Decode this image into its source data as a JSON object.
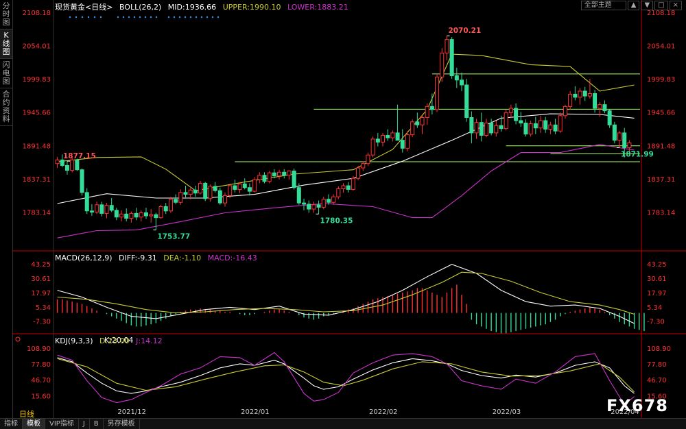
{
  "sidebar": {
    "tabs": [
      "分时图",
      "K线图",
      "闪电图",
      "合约资料"
    ],
    "active": 1
  },
  "header": {
    "instrument": "现货黄金<日线>",
    "boll": "BOLL(26,2)",
    "mid": "MID:1936.66",
    "upper": "UPPER:1990.10",
    "lower": "LOWER:1883.21",
    "theme_button": "全部主题"
  },
  "macd_header": {
    "name": "MACD(26,12,9)",
    "diff": "DIFF:-9.31",
    "dea": "DEA:-1.10",
    "macd": "MACD:-16.43"
  },
  "kdj_header": {
    "name": "KDJ(9,3,3)",
    "k": "K:20.04",
    "d": "D:23.00",
    "j": "J:14.12"
  },
  "period_label": "日线",
  "bottom_tabs": [
    "指标",
    "模板",
    "VIP指标",
    "J",
    "B",
    "另存模板"
  ],
  "watermark": "FX678",
  "colors": {
    "up": "#ff3333",
    "down": "#33dd99",
    "mid": "#ffffff",
    "upper": "#cccc33",
    "lower": "#cc33cc",
    "levels": "#aaff66",
    "bg": "#000000"
  },
  "chart_data": {
    "type": "candlestick",
    "main_axis": {
      "ticks": [
        "2108.18",
        "2054.01",
        "1999.83",
        "1945.66",
        "1891.48",
        "1837.31",
        "1783.14"
      ],
      "ylim": [
        1729,
        2108.18
      ]
    },
    "x_labels": [
      "2021/12",
      "2022/01",
      "2022/02",
      "2022/03",
      "2022/04"
    ],
    "annotations": [
      {
        "label": "1877.15",
        "index": 2,
        "type": "high"
      },
      {
        "label": "1753.77",
        "index": 20,
        "type": "low"
      },
      {
        "label": "1780.35",
        "index": 53,
        "type": "low"
      },
      {
        "label": "2070.21",
        "index": 79,
        "type": "high"
      },
      {
        "label": "1871.99",
        "index": 114,
        "type": "low"
      }
    ],
    "horizontal_levels": [
      2008,
      1950.5,
      1865,
      1878,
      1891
    ],
    "ohlc": [
      [
        1862,
        1873,
        1855,
        1868
      ],
      [
        1868,
        1877,
        1856,
        1859
      ],
      [
        1859,
        1866,
        1844,
        1851
      ],
      [
        1851,
        1872,
        1848,
        1868
      ],
      [
        1868,
        1870,
        1850,
        1852
      ],
      [
        1852,
        1854,
        1810,
        1815
      ],
      [
        1815,
        1822,
        1780,
        1785
      ],
      [
        1785,
        1796,
        1777,
        1783
      ],
      [
        1783,
        1800,
        1780,
        1795
      ],
      [
        1795,
        1800,
        1776,
        1781
      ],
      [
        1781,
        1798,
        1773,
        1794
      ],
      [
        1794,
        1806,
        1783,
        1786
      ],
      [
        1786,
        1790,
        1770,
        1775
      ],
      [
        1775,
        1786,
        1768,
        1780
      ],
      [
        1780,
        1789,
        1768,
        1773
      ],
      [
        1773,
        1784,
        1766,
        1781
      ],
      [
        1781,
        1790,
        1770,
        1775
      ],
      [
        1775,
        1786,
        1768,
        1782
      ],
      [
        1782,
        1790,
        1772,
        1777
      ],
      [
        1777,
        1788,
        1766,
        1779
      ],
      [
        1779,
        1782,
        1754,
        1774
      ],
      [
        1774,
        1795,
        1772,
        1792
      ],
      [
        1792,
        1798,
        1780,
        1785
      ],
      [
        1785,
        1808,
        1782,
        1804
      ],
      [
        1804,
        1812,
        1796,
        1799
      ],
      [
        1799,
        1820,
        1795,
        1815
      ],
      [
        1815,
        1826,
        1807,
        1812
      ],
      [
        1812,
        1822,
        1804,
        1819
      ],
      [
        1819,
        1826,
        1808,
        1814
      ],
      [
        1814,
        1834,
        1812,
        1830
      ],
      [
        1830,
        1832,
        1801,
        1805
      ],
      [
        1805,
        1828,
        1800,
        1825
      ],
      [
        1825,
        1832,
        1815,
        1818
      ],
      [
        1818,
        1823,
        1795,
        1798
      ],
      [
        1798,
        1815,
        1792,
        1810
      ],
      [
        1810,
        1829,
        1806,
        1826
      ],
      [
        1826,
        1836,
        1815,
        1820
      ],
      [
        1820,
        1832,
        1814,
        1829
      ],
      [
        1829,
        1838,
        1820,
        1823
      ],
      [
        1823,
        1830,
        1810,
        1817
      ],
      [
        1817,
        1840,
        1815,
        1836
      ],
      [
        1836,
        1848,
        1830,
        1843
      ],
      [
        1843,
        1848,
        1830,
        1833
      ],
      [
        1833,
        1850,
        1830,
        1847
      ],
      [
        1847,
        1853,
        1838,
        1842
      ],
      [
        1842,
        1852,
        1836,
        1848
      ],
      [
        1848,
        1853,
        1838,
        1843
      ],
      [
        1843,
        1851,
        1836,
        1850
      ],
      [
        1850,
        1854,
        1820,
        1823
      ],
      [
        1823,
        1830,
        1795,
        1798
      ],
      [
        1798,
        1805,
        1786,
        1796
      ],
      [
        1796,
        1802,
        1782,
        1788
      ],
      [
        1788,
        1800,
        1782,
        1795
      ],
      [
        1795,
        1802,
        1780,
        1791
      ],
      [
        1791,
        1808,
        1788,
        1804
      ],
      [
        1804,
        1812,
        1795,
        1799
      ],
      [
        1799,
        1812,
        1795,
        1808
      ],
      [
        1808,
        1825,
        1804,
        1821
      ],
      [
        1821,
        1830,
        1815,
        1826
      ],
      [
        1826,
        1832,
        1815,
        1820
      ],
      [
        1820,
        1842,
        1818,
        1838
      ],
      [
        1838,
        1858,
        1835,
        1855
      ],
      [
        1855,
        1866,
        1850,
        1862
      ],
      [
        1862,
        1880,
        1858,
        1876
      ],
      [
        1876,
        1906,
        1872,
        1902
      ],
      [
        1902,
        1912,
        1890,
        1897
      ],
      [
        1897,
        1912,
        1890,
        1908
      ],
      [
        1908,
        1918,
        1899,
        1904
      ],
      [
        1904,
        1916,
        1898,
        1912
      ],
      [
        1912,
        1958,
        1900,
        1900
      ],
      [
        1900,
        1918,
        1880,
        1887
      ],
      [
        1887,
        1915,
        1882,
        1909
      ],
      [
        1909,
        1934,
        1905,
        1930
      ],
      [
        1930,
        1945,
        1920,
        1925
      ],
      [
        1925,
        1940,
        1910,
        1937
      ],
      [
        1937,
        1960,
        1925,
        1955
      ],
      [
        1955,
        1976,
        1942,
        1950
      ],
      [
        1950,
        2008,
        1946,
        2003
      ],
      [
        2003,
        2050,
        1995,
        2042
      ],
      [
        2042,
        2070,
        2030,
        2064
      ],
      [
        2064,
        2068,
        2000,
        2005
      ],
      [
        2005,
        2018,
        1985,
        1998
      ],
      [
        1998,
        2010,
        1980,
        1990
      ],
      [
        1990,
        2000,
        1930,
        1937
      ],
      [
        1937,
        1947,
        1895,
        1912
      ],
      [
        1912,
        1935,
        1902,
        1929
      ],
      [
        1929,
        1945,
        1898,
        1908
      ],
      [
        1908,
        1935,
        1905,
        1928
      ],
      [
        1928,
        1935,
        1908,
        1912
      ],
      [
        1912,
        1932,
        1906,
        1924
      ],
      [
        1924,
        1940,
        1914,
        1919
      ],
      [
        1919,
        1950,
        1916,
        1945
      ],
      [
        1945,
        1958,
        1936,
        1952
      ],
      [
        1952,
        1960,
        1926,
        1932
      ],
      [
        1932,
        1946,
        1922,
        1928
      ],
      [
        1928,
        1934,
        1906,
        1910
      ],
      [
        1910,
        1932,
        1906,
        1927
      ],
      [
        1927,
        1938,
        1910,
        1920
      ],
      [
        1920,
        1940,
        1912,
        1932
      ],
      [
        1932,
        1938,
        1912,
        1918
      ],
      [
        1918,
        1930,
        1910,
        1925
      ],
      [
        1925,
        1935,
        1910,
        1915
      ],
      [
        1915,
        1945,
        1912,
        1940
      ],
      [
        1940,
        1958,
        1935,
        1955
      ],
      [
        1955,
        1980,
        1950,
        1975
      ],
      [
        1975,
        1988,
        1965,
        1970
      ],
      [
        1970,
        1985,
        1958,
        1980
      ],
      [
        1980,
        1987,
        1964,
        1972
      ],
      [
        1972,
        2000,
        1968,
        1976
      ],
      [
        1976,
        1982,
        1945,
        1952
      ],
      [
        1952,
        1962,
        1938,
        1958
      ],
      [
        1958,
        1965,
        1944,
        1948
      ],
      [
        1948,
        1950,
        1920,
        1925
      ],
      [
        1925,
        1930,
        1895,
        1900
      ],
      [
        1900,
        1915,
        1888,
        1912
      ],
      [
        1912,
        1920,
        1872,
        1888
      ],
      [
        1888,
        1900,
        1880,
        1896
      ]
    ],
    "boll_mid": [
      [
        0,
        1797
      ],
      [
        10,
        1813
      ],
      [
        20,
        1806
      ],
      [
        30,
        1806
      ],
      [
        40,
        1812
      ],
      [
        50,
        1827
      ],
      [
        60,
        1838
      ],
      [
        70,
        1866
      ],
      [
        80,
        1900
      ],
      [
        90,
        1936
      ],
      [
        100,
        1943
      ],
      [
        110,
        1942
      ],
      [
        117,
        1936
      ]
    ],
    "boll_upper": [
      [
        0,
        1865
      ],
      [
        8,
        1872
      ],
      [
        17,
        1873
      ],
      [
        22,
        1853
      ],
      [
        28,
        1818
      ],
      [
        38,
        1832
      ],
      [
        48,
        1845
      ],
      [
        60,
        1852
      ],
      [
        68,
        1885
      ],
      [
        75,
        1950
      ],
      [
        80,
        2040
      ],
      [
        86,
        2038
      ],
      [
        96,
        2023
      ],
      [
        104,
        2020
      ],
      [
        110,
        1980
      ],
      [
        117,
        1990
      ]
    ],
    "boll_lower": [
      [
        0,
        1741
      ],
      [
        8,
        1753
      ],
      [
        16,
        1754
      ],
      [
        24,
        1766
      ],
      [
        34,
        1782
      ],
      [
        44,
        1790
      ],
      [
        54,
        1797
      ],
      [
        64,
        1792
      ],
      [
        72,
        1774
      ],
      [
        76,
        1774
      ],
      [
        82,
        1810
      ],
      [
        88,
        1850
      ],
      [
        94,
        1880
      ],
      [
        102,
        1880
      ],
      [
        110,
        1893
      ],
      [
        117,
        1884
      ]
    ],
    "macd_axis": {
      "ticks": [
        "43.25",
        "30.61",
        "17.97",
        "5.34",
        "-7.30"
      ],
      "ylim": [
        -19,
        44
      ]
    },
    "diff": [
      [
        0,
        20
      ],
      [
        5,
        14
      ],
      [
        10,
        5
      ],
      [
        15,
        -3
      ],
      [
        20,
        -5
      ],
      [
        25,
        -1
      ],
      [
        30,
        3
      ],
      [
        35,
        5
      ],
      [
        40,
        3
      ],
      [
        45,
        6
      ],
      [
        50,
        -1
      ],
      [
        55,
        -2
      ],
      [
        60,
        3
      ],
      [
        65,
        10
      ],
      [
        70,
        20
      ],
      [
        75,
        32
      ],
      [
        80,
        43
      ],
      [
        85,
        35
      ],
      [
        90,
        20
      ],
      [
        95,
        10
      ],
      [
        100,
        6
      ],
      [
        105,
        7
      ],
      [
        110,
        4
      ],
      [
        114,
        -3
      ],
      [
        117,
        -9.3
      ]
    ],
    "dea": [
      [
        0,
        14
      ],
      [
        6,
        12
      ],
      [
        12,
        8
      ],
      [
        18,
        3
      ],
      [
        24,
        0
      ],
      [
        30,
        1
      ],
      [
        36,
        3
      ],
      [
        42,
        4
      ],
      [
        48,
        3
      ],
      [
        54,
        1
      ],
      [
        60,
        2
      ],
      [
        66,
        7
      ],
      [
        72,
        16
      ],
      [
        78,
        27
      ],
      [
        82,
        36
      ],
      [
        86,
        35
      ],
      [
        92,
        28
      ],
      [
        98,
        18
      ],
      [
        104,
        10
      ],
      [
        110,
        7
      ],
      [
        114,
        3
      ],
      [
        117,
        -1.1
      ]
    ],
    "macd_hist": [
      12,
      12,
      11,
      10,
      9,
      8,
      6,
      4,
      2,
      0,
      -1,
      -3,
      -5,
      -7,
      -9,
      -11,
      -12,
      -12,
      -11,
      -10,
      -9,
      -7,
      -5,
      -3,
      -1,
      1,
      2,
      3,
      3,
      4,
      3,
      3,
      2,
      2,
      1,
      1,
      0,
      -1,
      -2,
      -2,
      -1,
      0,
      1,
      2,
      3,
      3,
      2,
      1,
      0,
      -2,
      -4,
      -5,
      -6,
      -5,
      -3,
      -2,
      -1,
      0,
      2,
      3,
      4,
      6,
      8,
      10,
      12,
      13,
      14,
      15,
      16,
      17,
      18,
      19,
      20,
      22,
      22,
      20,
      18,
      16,
      14,
      18,
      22,
      25,
      16,
      8,
      -6,
      -10,
      -12,
      -14,
      -16,
      -17,
      -18,
      -18,
      -17,
      -16,
      -15,
      -14,
      -13,
      -12,
      -11,
      -10,
      -8,
      -6,
      -3,
      -1,
      1,
      2,
      3,
      4,
      5,
      4,
      3,
      1,
      -2,
      -5,
      -8,
      -10,
      -12,
      -14,
      -15,
      -16
    ],
    "kdj_axis": {
      "ticks": [
        "108.90",
        "77.80",
        "46.70",
        "15.60"
      ],
      "ylim": [
        -4,
        110
      ]
    },
    "k": [
      [
        0,
        90
      ],
      [
        3,
        82
      ],
      [
        6,
        60
      ],
      [
        9,
        40
      ],
      [
        12,
        25
      ],
      [
        15,
        20
      ],
      [
        18,
        25
      ],
      [
        21,
        33
      ],
      [
        25,
        42
      ],
      [
        29,
        55
      ],
      [
        33,
        70
      ],
      [
        37,
        78
      ],
      [
        40,
        75
      ],
      [
        44,
        85
      ],
      [
        46,
        78
      ],
      [
        50,
        50
      ],
      [
        52,
        35
      ],
      [
        54,
        28
      ],
      [
        57,
        33
      ],
      [
        60,
        48
      ],
      [
        64,
        66
      ],
      [
        68,
        80
      ],
      [
        72,
        88
      ],
      [
        76,
        84
      ],
      [
        79,
        78
      ],
      [
        82,
        65
      ],
      [
        86,
        55
      ],
      [
        90,
        50
      ],
      [
        93,
        56
      ],
      [
        97,
        52
      ],
      [
        101,
        60
      ],
      [
        105,
        75
      ],
      [
        109,
        82
      ],
      [
        112,
        70
      ],
      [
        115,
        35
      ],
      [
        117,
        20
      ]
    ],
    "d": [
      [
        0,
        88
      ],
      [
        6,
        72
      ],
      [
        12,
        40
      ],
      [
        18,
        26
      ],
      [
        24,
        33
      ],
      [
        30,
        48
      ],
      [
        36,
        62
      ],
      [
        42,
        74
      ],
      [
        46,
        76
      ],
      [
        50,
        62
      ],
      [
        54,
        42
      ],
      [
        58,
        35
      ],
      [
        62,
        46
      ],
      [
        68,
        68
      ],
      [
        74,
        82
      ],
      [
        80,
        78
      ],
      [
        86,
        62
      ],
      [
        92,
        54
      ],
      [
        98,
        55
      ],
      [
        104,
        64
      ],
      [
        110,
        78
      ],
      [
        114,
        52
      ],
      [
        117,
        23
      ]
    ],
    "j": [
      [
        0,
        95
      ],
      [
        3,
        85
      ],
      [
        6,
        45
      ],
      [
        9,
        12
      ],
      [
        12,
        2
      ],
      [
        15,
        8
      ],
      [
        18,
        22
      ],
      [
        21,
        35
      ],
      [
        25,
        58
      ],
      [
        29,
        70
      ],
      [
        33,
        92
      ],
      [
        37,
        90
      ],
      [
        40,
        75
      ],
      [
        44,
        100
      ],
      [
        46,
        82
      ],
      [
        50,
        20
      ],
      [
        52,
        5
      ],
      [
        54,
        8
      ],
      [
        57,
        22
      ],
      [
        60,
        60
      ],
      [
        64,
        80
      ],
      [
        68,
        95
      ],
      [
        72,
        98
      ],
      [
        76,
        92
      ],
      [
        79,
        78
      ],
      [
        82,
        45
      ],
      [
        86,
        35
      ],
      [
        90,
        28
      ],
      [
        93,
        48
      ],
      [
        97,
        40
      ],
      [
        101,
        62
      ],
      [
        105,
        92
      ],
      [
        109,
        98
      ],
      [
        112,
        45
      ],
      [
        115,
        -2
      ],
      [
        117,
        14
      ]
    ]
  }
}
